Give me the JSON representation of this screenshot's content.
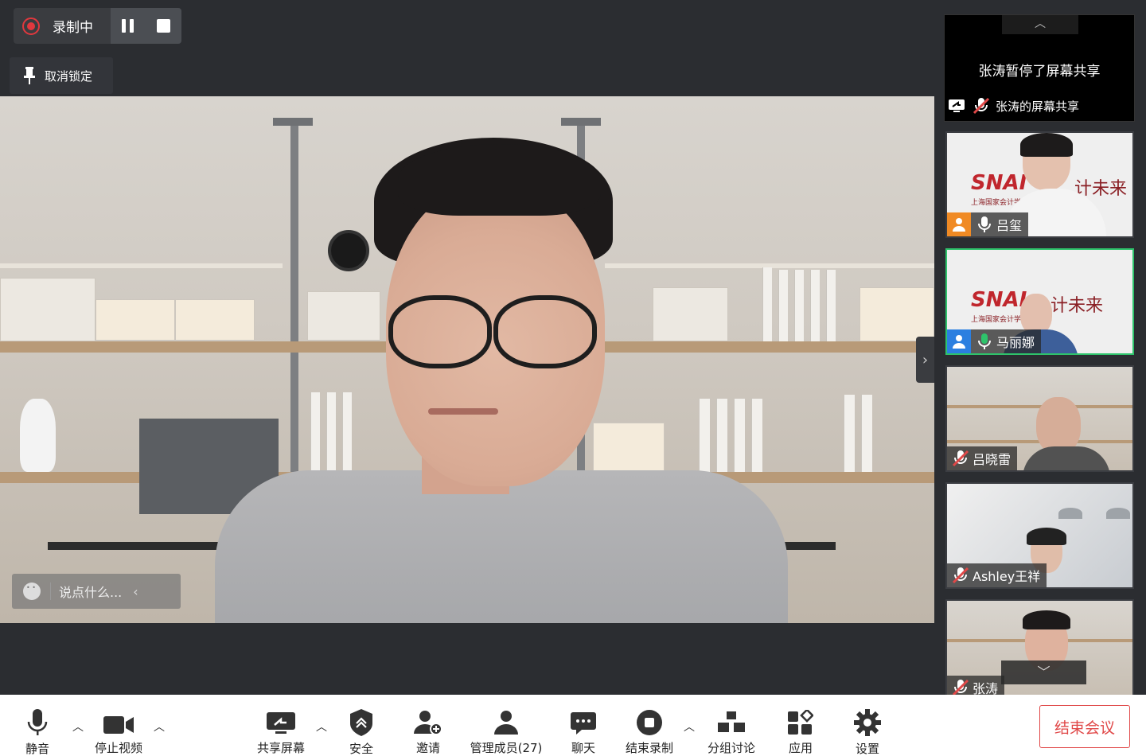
{
  "recording": {
    "status_label": "录制中"
  },
  "pin": {
    "label": "取消锁定"
  },
  "chat": {
    "placeholder": "说点什么..."
  },
  "share_tile": {
    "message": "张涛暂停了屏幕共享",
    "owner_label": "张涛的屏幕共享"
  },
  "participants": [
    {
      "name": "吕玺",
      "mic": "on",
      "role_badge_color": "#f08a24"
    },
    {
      "name": "马丽娜",
      "mic": "on",
      "role_badge_color": "#2b7fe0",
      "active_speaker": true
    },
    {
      "name": "吕晓雷",
      "mic": "muted"
    },
    {
      "name": "Ashley王祥",
      "mic": "muted"
    },
    {
      "name": "张涛",
      "mic": "muted"
    }
  ],
  "tile_logo_text": "SNAI",
  "tile_logo_slogan": "计未来",
  "tile_logo_sub": "上海国家会计学院",
  "toolbar": {
    "mute": "静音",
    "stop_video": "停止视频",
    "share_screen": "共享屏幕",
    "security": "安全",
    "invite": "邀请",
    "manage_participants": "管理成员(27)",
    "chat": "聊天",
    "end_recording": "结束录制",
    "breakout": "分组讨论",
    "apps": "应用",
    "settings": "设置",
    "end_meeting": "结束会议"
  },
  "colors": {
    "accent_red": "#e04848",
    "active_green": "#2ec36b",
    "background": "#2b2d31"
  }
}
